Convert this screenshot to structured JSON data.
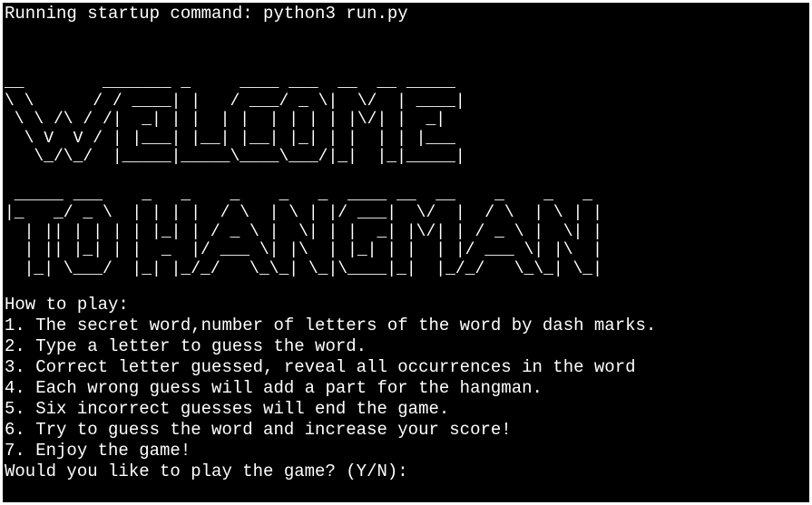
{
  "terminal": {
    "startup_line": "Running startup command: python3 run.py",
    "banner_text": "__        _______ _     ____ ___  __  __ _____\n\\ \\      / / ____| |   / ___/ _ \\|  \\/  | ____|\n \\ \\ /\\ / /|  _| | |  | |  | | | | |\\/| |  _|\n  \\ V  V / | |___| |__| |__| |_| | |  | | |___\n   \\_/\\_/  |_____|_____\\____\\___/|_|  |_|_____|\n\n _____ ___    _   _    _    _   _  ____ __  __    _    _   _\n|_   _/ _ \\  | | | |  / \\  | \\ | |/ ___|  \\/  |  / \\  | \\ | |\n  | || | | | | |_| | / _ \\ |  \\| | |  _| |\\/| | / _ \\ |  \\| |\n  | || |_| | |  _  |/ ___ \\| |\\  | |_| | |  | |/ ___ \\| |\\  |\n  |_| \\___/  |_| |_/_/   \\_\\_| \\_|\\____|_|  |_/_/   \\_\\_| \\_|",
    "how_to_play_heading": "How to play:",
    "instructions": [
      "1. The secret word,number of letters of the word by dash marks.",
      "2. Type a letter to guess the word.",
      "3. Correct letter guessed, reveal all occurrences in the word",
      "4. Each wrong guess will add a part for the hangman.",
      "5. Six incorrect guesses will end the game.",
      "6. Try to guess the word and increase your score!",
      "7. Enjoy the game!"
    ],
    "prompt": "Would you like to play the game? (Y/N):"
  }
}
